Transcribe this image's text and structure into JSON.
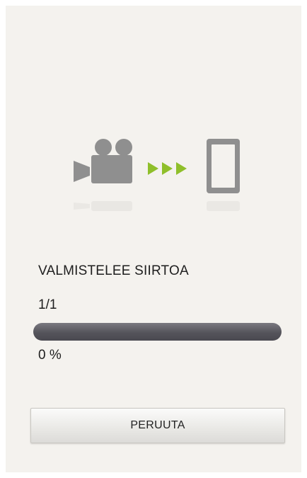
{
  "dialog": {
    "status_text": "VALMISTELEE SIIRTOA",
    "file_count": "1/1",
    "progress_fraction": 0,
    "percent_text": "0 %",
    "cancel_label": "PERUUTA"
  },
  "illustration": {
    "source_icon": "video-camera-icon",
    "transfer_icon": "transfer-arrows-icon",
    "target_icon": "smartphone-icon"
  },
  "colors": {
    "background": "#f4f2ee",
    "icon_gray": "#8f8f8f",
    "arrow_green": "#8fbf2a",
    "progress_track": "#55545b"
  }
}
